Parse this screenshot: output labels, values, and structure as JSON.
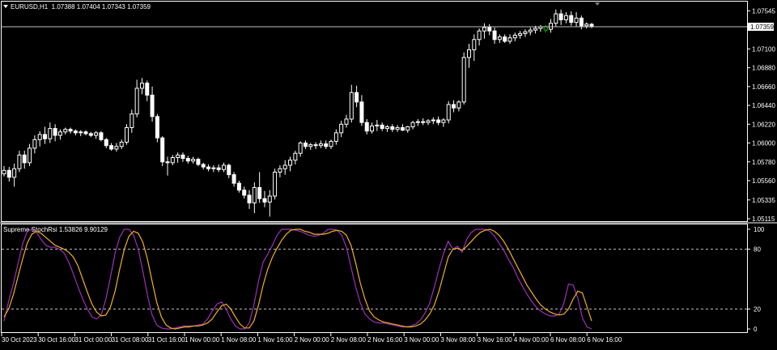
{
  "header": {
    "symbol": "EURUSD,H1",
    "ohlc": "1.07388 1.07404 1.07343 1.07359"
  },
  "indicator": {
    "title": "Supreme StochRsi 1.53826 9.90129"
  },
  "colors": {
    "background": "#000000",
    "grid": "#ffffff",
    "candle": "#ffffff",
    "last_bull_candle": "#00c000",
    "k_line": "#9b30b8",
    "d_line": "#f0b020",
    "price_line": "#c0c0c0"
  },
  "chart_data": [
    {
      "type": "candlestick",
      "title": "EURUSD,H1",
      "y_ticks": [
        "1.07545",
        "1.07100",
        "1.06880",
        "1.06660",
        "1.06440",
        "1.06220",
        "1.06000",
        "1.05780",
        "1.05560",
        "1.05335",
        "1.05115"
      ],
      "ylim": [
        1.05115,
        1.07615
      ],
      "current_price": "1.07359",
      "candles": [
        [
          1.0564,
          1.0573,
          1.0561,
          1.0568
        ],
        [
          1.0568,
          1.0572,
          1.0555,
          1.056
        ],
        [
          1.056,
          1.0576,
          1.0549,
          1.057
        ],
        [
          1.057,
          1.0591,
          1.0566,
          1.0586
        ],
        [
          1.0586,
          1.0591,
          1.057,
          1.0577
        ],
        [
          1.0577,
          1.0599,
          1.0573,
          1.0594
        ],
        [
          1.0594,
          1.0609,
          1.0588,
          1.0604
        ],
        [
          1.0604,
          1.0614,
          1.0596,
          1.061
        ],
        [
          1.061,
          1.0619,
          1.0599,
          1.0605
        ],
        [
          1.0605,
          1.0624,
          1.06,
          1.0617
        ],
        [
          1.0617,
          1.0622,
          1.0602,
          1.0609
        ],
        [
          1.0609,
          1.0616,
          1.0604,
          1.0613
        ],
        [
          1.0613,
          1.0618,
          1.061,
          1.0616
        ],
        [
          1.0616,
          1.0618,
          1.0611,
          1.0614
        ],
        [
          1.0614,
          1.0616,
          1.0609,
          1.0612
        ],
        [
          1.0612,
          1.0615,
          1.0608,
          1.0613
        ],
        [
          1.0613,
          1.0615,
          1.0609,
          1.0611
        ],
        [
          1.0611,
          1.0613,
          1.0607,
          1.0609
        ],
        [
          1.0609,
          1.0614,
          1.0605,
          1.0612
        ],
        [
          1.0612,
          1.0614,
          1.0602,
          1.0604
        ],
        [
          1.0604,
          1.0606,
          1.0594,
          1.0597
        ],
        [
          1.0597,
          1.06,
          1.0591,
          1.0593
        ],
        [
          1.0593,
          1.06,
          1.059,
          1.0596
        ],
        [
          1.0596,
          1.0604,
          1.0593,
          1.0601
        ],
        [
          1.0601,
          1.0622,
          1.0598,
          1.0618
        ],
        [
          1.0618,
          1.0639,
          1.0612,
          1.0634
        ],
        [
          1.0634,
          1.0674,
          1.063,
          1.0664
        ],
        [
          1.0664,
          1.0676,
          1.0657,
          1.067
        ],
        [
          1.067,
          1.0673,
          1.0649,
          1.0656
        ],
        [
          1.0656,
          1.0666,
          1.0625,
          1.0631
        ],
        [
          1.0631,
          1.0634,
          1.0601,
          1.0606
        ],
        [
          1.0606,
          1.0608,
          1.0573,
          1.0578
        ],
        [
          1.0578,
          1.0584,
          1.0562,
          1.0577
        ],
        [
          1.0577,
          1.0586,
          1.0574,
          1.0583
        ],
        [
          1.0583,
          1.0589,
          1.0577,
          1.0586
        ],
        [
          1.0586,
          1.0589,
          1.0578,
          1.0582
        ],
        [
          1.0582,
          1.0585,
          1.0576,
          1.0579
        ],
        [
          1.0579,
          1.0584,
          1.0576,
          1.0581
        ],
        [
          1.0581,
          1.0583,
          1.0573,
          1.0575
        ],
        [
          1.0575,
          1.0577,
          1.0569,
          1.0572
        ],
        [
          1.0572,
          1.0575,
          1.0567,
          1.057
        ],
        [
          1.057,
          1.0574,
          1.0566,
          1.0571
        ],
        [
          1.0571,
          1.0575,
          1.0566,
          1.0569
        ],
        [
          1.0569,
          1.0577,
          1.0566,
          1.0574
        ],
        [
          1.0574,
          1.0576,
          1.0559,
          1.0563
        ],
        [
          1.0563,
          1.0566,
          1.0549,
          1.0553
        ],
        [
          1.0553,
          1.0556,
          1.0542,
          1.0545
        ],
        [
          1.0545,
          1.0549,
          1.0535,
          1.0539
        ],
        [
          1.0539,
          1.0545,
          1.0523,
          1.053
        ],
        [
          1.053,
          1.0554,
          1.0518,
          1.0548
        ],
        [
          1.0548,
          1.0566,
          1.053,
          1.0535
        ],
        [
          1.0535,
          1.0544,
          1.0525,
          1.0531
        ],
        [
          1.0531,
          1.0545,
          1.0514,
          1.0538
        ],
        [
          1.0538,
          1.057,
          1.0534,
          1.0566
        ],
        [
          1.0566,
          1.0574,
          1.056,
          1.057
        ],
        [
          1.057,
          1.058,
          1.0563,
          1.0574
        ],
        [
          1.0574,
          1.0584,
          1.0567,
          1.058
        ],
        [
          1.058,
          1.0591,
          1.0575,
          1.0588
        ],
        [
          1.0588,
          1.0602,
          1.0584,
          1.06
        ],
        [
          1.06,
          1.0603,
          1.0593,
          1.0596
        ],
        [
          1.0596,
          1.06,
          1.0592,
          1.0598
        ],
        [
          1.0598,
          1.0601,
          1.0593,
          1.0597
        ],
        [
          1.0597,
          1.0603,
          1.0594,
          1.0599
        ],
        [
          1.0599,
          1.0603,
          1.0593,
          1.0596
        ],
        [
          1.0596,
          1.0604,
          1.0593,
          1.0602
        ],
        [
          1.0602,
          1.0616,
          1.0598,
          1.0612
        ],
        [
          1.0612,
          1.0626,
          1.0607,
          1.0622
        ],
        [
          1.0622,
          1.0633,
          1.0618,
          1.0628
        ],
        [
          1.0628,
          1.0668,
          1.0624,
          1.0659
        ],
        [
          1.0659,
          1.0667,
          1.0642,
          1.0648
        ],
        [
          1.0648,
          1.0656,
          1.062,
          1.0624
        ],
        [
          1.0624,
          1.0628,
          1.061,
          1.0614
        ],
        [
          1.0614,
          1.0624,
          1.0611,
          1.062
        ],
        [
          1.062,
          1.0627,
          1.0614,
          1.0621
        ],
        [
          1.0621,
          1.0624,
          1.0614,
          1.0617
        ],
        [
          1.0617,
          1.0621,
          1.0613,
          1.0619
        ],
        [
          1.0619,
          1.0622,
          1.0613,
          1.0616
        ],
        [
          1.0616,
          1.0621,
          1.0613,
          1.0618
        ],
        [
          1.0618,
          1.0622,
          1.0614,
          1.0615
        ],
        [
          1.0615,
          1.062,
          1.0612,
          1.0619
        ],
        [
          1.0619,
          1.0626,
          1.0616,
          1.0624
        ],
        [
          1.0624,
          1.0628,
          1.062,
          1.0625
        ],
        [
          1.0625,
          1.0629,
          1.0621,
          1.0624
        ],
        [
          1.0624,
          1.0628,
          1.0621,
          1.0626
        ],
        [
          1.0626,
          1.063,
          1.0622,
          1.0627
        ],
        [
          1.0627,
          1.0631,
          1.0621,
          1.0624
        ],
        [
          1.0624,
          1.0629,
          1.0619,
          1.0627
        ],
        [
          1.0627,
          1.0649,
          1.0623,
          1.0645
        ],
        [
          1.0645,
          1.065,
          1.0636,
          1.0641
        ],
        [
          1.0641,
          1.065,
          1.0637,
          1.0648
        ],
        [
          1.0648,
          1.0706,
          1.0645,
          1.07
        ],
        [
          1.07,
          1.0716,
          1.0688,
          1.0709
        ],
        [
          1.0709,
          1.0727,
          1.0696,
          1.0721
        ],
        [
          1.0721,
          1.0734,
          1.0714,
          1.0731
        ],
        [
          1.0731,
          1.074,
          1.0722,
          1.0735
        ],
        [
          1.0735,
          1.0739,
          1.0726,
          1.0731
        ],
        [
          1.0731,
          1.0735,
          1.0716,
          1.0721
        ],
        [
          1.0721,
          1.0727,
          1.0717,
          1.0724
        ],
        [
          1.0724,
          1.0727,
          1.0717,
          1.0719
        ],
        [
          1.0719,
          1.0727,
          1.0716,
          1.0723
        ],
        [
          1.0723,
          1.0729,
          1.0719,
          1.0726
        ],
        [
          1.0726,
          1.0731,
          1.0722,
          1.0728
        ],
        [
          1.0728,
          1.0733,
          1.0724,
          1.073
        ],
        [
          1.073,
          1.0735,
          1.0726,
          1.0732
        ],
        [
          1.0732,
          1.0737,
          1.0728,
          1.0734
        ],
        [
          1.0734,
          1.0738,
          1.073,
          1.0736
        ],
        [
          1.0732,
          1.0738,
          1.0729,
          1.0736
        ],
        [
          1.0733,
          1.0745,
          1.0729,
          1.074
        ],
        [
          1.074,
          1.0756,
          1.0736,
          1.0751
        ],
        [
          1.0751,
          1.0756,
          1.0738,
          1.0744
        ],
        [
          1.0744,
          1.0753,
          1.074,
          1.0749
        ],
        [
          1.0749,
          1.0754,
          1.0737,
          1.0741
        ],
        [
          1.0741,
          1.0753,
          1.0736,
          1.0746
        ],
        [
          1.0746,
          1.0749,
          1.0733,
          1.0737
        ],
        [
          1.0737,
          1.0741,
          1.0734,
          1.0739
        ],
        [
          1.07388,
          1.07404,
          1.07343,
          1.07359
        ]
      ],
      "last_bull_index": 106
    },
    {
      "type": "line",
      "title": "Supreme StochRsi 1.53826 9.90129",
      "y_ticks": [
        "100",
        "80",
        "20",
        "0"
      ],
      "ylim": [
        0,
        100
      ],
      "levels": [
        80,
        20
      ],
      "x_labels": [
        "30 Oct 2023",
        "30 Oct 16:00",
        "31 Oct 00:00",
        "31 Oct 08:00",
        "31 Oct 16:00",
        "1 Nov 00:00",
        "1 Nov 08:00",
        "1 Nov 16:00",
        "2 Nov 00:00",
        "2 Nov 08:00",
        "2 Nov 16:00",
        "3 Nov 00:00",
        "3 Nov 08:00",
        "3 Nov 16:00",
        "4 Nov 00:00",
        "6 Nov 08:00",
        "6 Nov 16:00"
      ],
      "series": [
        {
          "role": "k",
          "values": [
            8,
            28,
            45,
            65,
            85,
            98,
            100,
            97,
            90,
            84,
            82,
            82,
            80,
            76,
            67,
            55,
            42,
            30,
            20,
            12,
            10,
            14,
            30,
            52,
            76,
            92,
            100,
            100,
            94,
            80,
            58,
            34,
            14,
            4,
            1,
            0,
            0,
            1,
            2,
            3,
            3,
            3,
            4,
            5,
            10,
            18,
            25,
            27,
            20,
            10,
            3,
            0,
            0,
            6,
            24,
            48,
            67,
            75,
            84,
            94,
            100,
            100,
            100,
            99,
            98,
            96,
            94,
            93,
            94,
            96,
            100,
            100,
            99,
            94,
            82,
            62,
            42,
            26,
            15,
            10,
            7,
            6,
            6,
            5,
            4,
            3,
            2,
            2,
            3,
            5,
            9,
            16,
            26,
            42,
            60,
            76,
            88,
            80,
            83,
            77,
            90,
            97,
            100,
            100,
            100,
            98,
            93,
            86,
            79,
            70,
            62,
            52,
            43,
            35,
            28,
            22,
            18,
            15,
            13,
            13,
            15,
            26,
            45,
            44,
            31,
            11,
            2,
            0
          ]
        },
        {
          "role": "d",
          "values": [
            12,
            20,
            34,
            52,
            70,
            86,
            95,
            98,
            96,
            92,
            88,
            84,
            82,
            80,
            77,
            72,
            63,
            50,
            37,
            25,
            17,
            13,
            14,
            22,
            38,
            60,
            80,
            93,
            98,
            96,
            87,
            70,
            48,
            27,
            12,
            4,
            1,
            0,
            1,
            2,
            2,
            3,
            3,
            4,
            6,
            10,
            17,
            23,
            25,
            20,
            12,
            5,
            1,
            1,
            8,
            24,
            44,
            60,
            72,
            81,
            89,
            95,
            99,
            100,
            100,
            98,
            97,
            95,
            95,
            95,
            96,
            98,
            99,
            98,
            94,
            84,
            66,
            46,
            30,
            18,
            12,
            9,
            7,
            6,
            5,
            4,
            3,
            2,
            2,
            3,
            5,
            9,
            15,
            24,
            38,
            55,
            72,
            80,
            81,
            79,
            83,
            88,
            93,
            97,
            99,
            100,
            98,
            94,
            88,
            80,
            71,
            62,
            53,
            44,
            37,
            30,
            24,
            20,
            17,
            15,
            14,
            15,
            20,
            30,
            38,
            36,
            22,
            8
          ]
        }
      ]
    }
  ]
}
